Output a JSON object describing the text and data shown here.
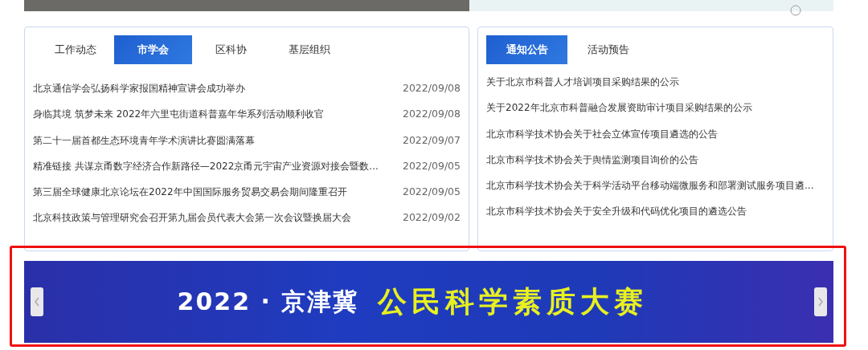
{
  "left_panel": {
    "tabs": [
      {
        "label": "工作动态",
        "selected": false
      },
      {
        "label": "市学会",
        "selected": true
      },
      {
        "label": "区科协",
        "selected": false
      },
      {
        "label": "基层组织",
        "selected": false
      }
    ],
    "news": [
      {
        "title": "北京通信学会弘扬科学家报国精神宣讲会成功举办",
        "date": "2022/09/08"
      },
      {
        "title": "身临其境 筑梦未来 2022年六里屯街道科普嘉年华系列活动顺利收官",
        "date": "2022/09/08"
      },
      {
        "title": "第二十一届首都生态环境青年学术演讲比赛圆满落幕",
        "date": "2022/09/07"
      },
      {
        "title": "精准链接 共谋京甬数字经济合作新路径—2022京甬元宇宙产业资源对接会暨数...",
        "date": "2022/09/05"
      },
      {
        "title": "第三届全球健康北京论坛在2022年中国国际服务贸易交易会期间隆重召开",
        "date": "2022/09/05"
      },
      {
        "title": "北京科技政策与管理研究会召开第九届会员代表大会第一次会议暨换届大会",
        "date": "2022/09/02"
      }
    ]
  },
  "right_panel": {
    "tabs": [
      {
        "label": "通知公告",
        "selected": true
      },
      {
        "label": "活动预告",
        "selected": false
      }
    ],
    "notices": [
      "关于北京市科普人才培训项目采购结果的公示",
      "关于2022年北京市科普融合发展资助审计项目采购结果的公示",
      "北京市科学技术协会关于社会立体宣传项目遴选的公告",
      "北京市科学技术协会关于舆情监测项目询价的公告",
      "北京市科学技术协会关于科学活动平台移动端微服务和部署测试服务项目遴...",
      "北京市科学技术协会关于安全升级和代码优化项目的遴选公告"
    ]
  },
  "banner": {
    "year": "2022 · 京津冀",
    "title": "公民科学素质大赛",
    "highlighted": true
  }
}
